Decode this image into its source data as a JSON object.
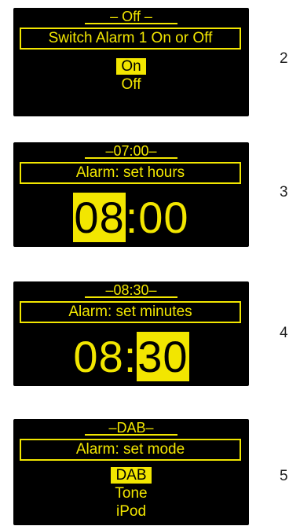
{
  "screens": [
    {
      "header": "– Off –",
      "title": "Switch Alarm 1 On or Off",
      "options": [
        {
          "label": "On",
          "selected": true
        },
        {
          "label": "Off",
          "selected": false
        }
      ],
      "step": "2"
    },
    {
      "header": "–07:00–",
      "title": "Alarm: set hours",
      "clock": {
        "hours": "08",
        "minutes": "00",
        "separator": ":",
        "highlight": "hours"
      },
      "step": "3"
    },
    {
      "header": "–08:30–",
      "title": "Alarm: set minutes",
      "clock": {
        "hours": "08",
        "minutes": "30",
        "separator": ":",
        "highlight": "minutes"
      },
      "step": "4"
    },
    {
      "header": "–DAB–",
      "title": "Alarm: set mode",
      "options": [
        {
          "label": "DAB",
          "selected": true
        },
        {
          "label": "Tone",
          "selected": false
        },
        {
          "label": "iPod",
          "selected": false
        }
      ],
      "step": "5"
    }
  ],
  "colors": {
    "accent": "#f2e600",
    "screen_bg": "#000000"
  }
}
